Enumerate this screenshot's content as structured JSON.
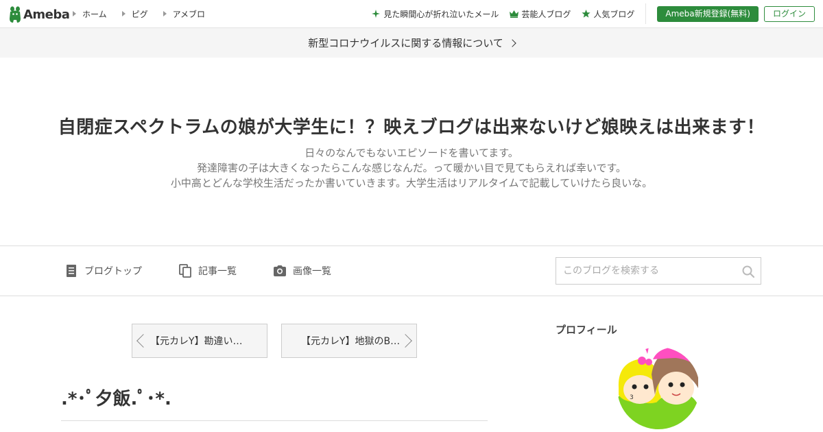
{
  "header": {
    "logo_text": "Ameba",
    "nav": [
      {
        "label": "ホーム"
      },
      {
        "label": "ピグ"
      },
      {
        "label": "アメブロ"
      }
    ],
    "links": [
      {
        "label": "見た瞬間心が折れ泣いたメール",
        "icon": "sparkle-icon"
      },
      {
        "label": "芸能人ブログ",
        "icon": "crown-icon"
      },
      {
        "label": "人気ブログ",
        "icon": "star-icon"
      }
    ],
    "register_label": "Ameba新規登録(無料)",
    "login_label": "ログイン",
    "accent_color": "#2d8c3c"
  },
  "notice": {
    "text": "新型コロナウイルスに関する情報について"
  },
  "blog": {
    "title": "自閉症スペクトラムの娘が大学生に！？映えブログは出来ないけど娘映えは出来ます！",
    "description": [
      "日々のなんでもないエピソードを書いてます。",
      "発達障害の子は大きくなったらこんな感じなんだ。って暖かい目で見てもらえれば幸いです。",
      "小中高とどんな学校生活だったか書いていきます。大学生活はリアルタイムで記載していけたら良いな。"
    ]
  },
  "blog_nav": {
    "items": [
      {
        "label": "ブログトップ",
        "icon": "document-icon"
      },
      {
        "label": "記事一覧",
        "icon": "copy-icon"
      },
      {
        "label": "画像一覧",
        "icon": "camera-icon"
      }
    ],
    "search_placeholder": "このブログを検索する"
  },
  "pager": {
    "prev_label": "【元カレY】勘違い…",
    "next_label": "【元カレY】地獄のB…"
  },
  "entry": {
    "title": ".*･ﾟ夕飯.ﾟ･*."
  },
  "sidebar": {
    "profile_heading": "プロフィール"
  }
}
